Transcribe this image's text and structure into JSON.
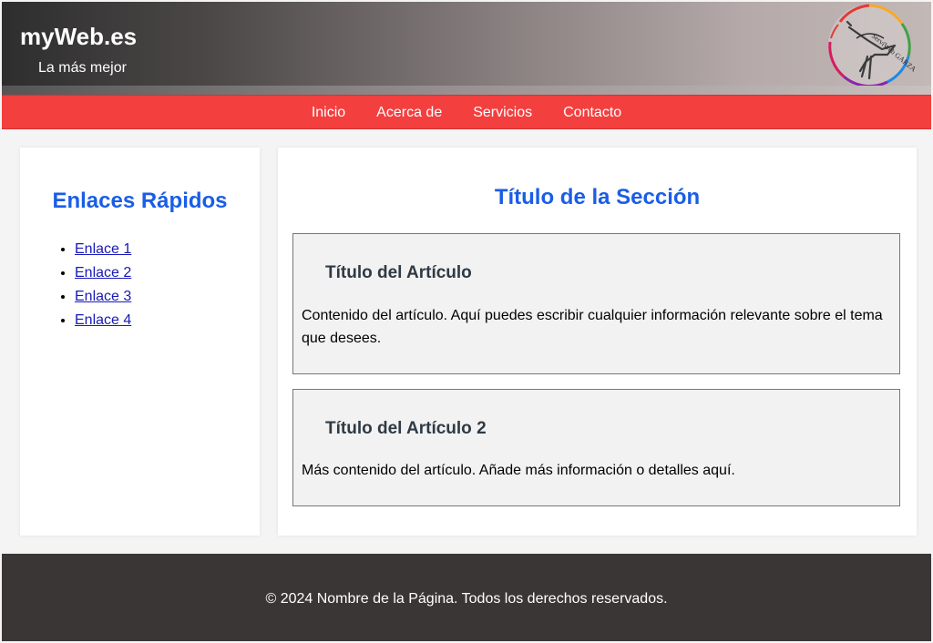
{
  "header": {
    "title": "myWeb.es",
    "subtitle": "La más mejor",
    "logo_icon": "stork-ring-logo-icon",
    "logo_text": "ServiWeb GARZA",
    "logo_colors": [
      "#e53935",
      "#f9a825",
      "#43a047",
      "#1e88e5",
      "#8e24aa",
      "#d81b60"
    ]
  },
  "nav": {
    "items": [
      {
        "label": "Inicio"
      },
      {
        "label": "Acerca de"
      },
      {
        "label": "Servicios"
      },
      {
        "label": "Contacto"
      }
    ],
    "background": "#f43f3f"
  },
  "sidebar": {
    "title": "Enlaces Rápidos",
    "links": [
      {
        "label": "Enlace 1"
      },
      {
        "label": "Enlace 2"
      },
      {
        "label": "Enlace 3"
      },
      {
        "label": "Enlace 4"
      }
    ]
  },
  "main": {
    "section_title": "Título de la Sección",
    "articles": [
      {
        "title": "Título del Artículo",
        "text": "Contenido del artículo. Aquí puedes escribir cualquier información relevante sobre el tema que desees."
      },
      {
        "title": "Título del Artículo 2",
        "text": "Más contenido del artículo. Añade más información o detalles aquí."
      }
    ]
  },
  "footer": {
    "text": "© 2024 Nombre de la Página. Todos los derechos reservados."
  },
  "colors": {
    "accent_blue": "#1a5ee6",
    "footer_bg": "#3a3636",
    "link": "#1919b8"
  }
}
